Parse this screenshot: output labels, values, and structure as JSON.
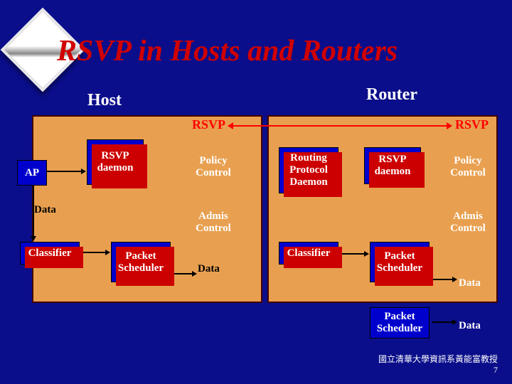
{
  "title": "RSVP in Hosts and Routers",
  "labels": {
    "host": "Host",
    "router": "Router",
    "rsvp_left": "RSVP",
    "rsvp_right": "RSVP",
    "data_in": "Data",
    "data_host_out": "Data",
    "data_router_out": "Data",
    "data_final": "Data"
  },
  "host": {
    "ap": "AP",
    "rsvp_daemon": "RSVP daemon",
    "policy": "Policy Control",
    "admis": "Admis Control",
    "classifier": "Classifier",
    "scheduler": "Packet Scheduler"
  },
  "router": {
    "routing": "Routing Protocol Daemon",
    "rsvp_daemon": "RSVP daemon",
    "policy": "Policy Control",
    "admis": "Admis Control",
    "classifier": "Classifier",
    "scheduler": "Packet Scheduler",
    "scheduler2": "Packet Scheduler"
  },
  "footer": {
    "text": "國立清華大學資訊系黃能富教授",
    "page": "7"
  }
}
